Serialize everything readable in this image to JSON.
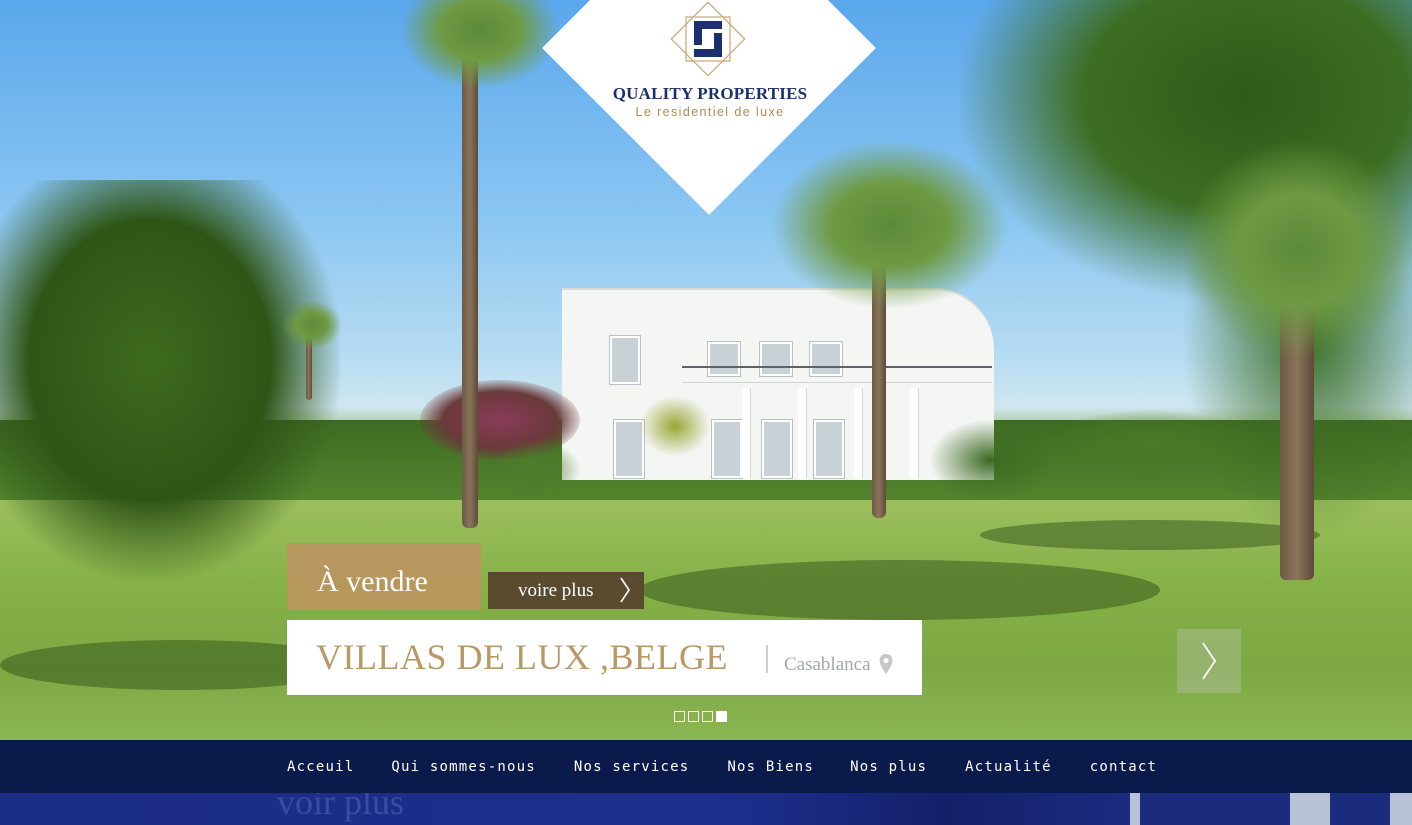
{
  "brand": {
    "name": "QUALITY PROPERTIES",
    "tagline": "Le residentiel de luxe",
    "colors": {
      "navy": "#1c2f6e",
      "gold": "#b08b55",
      "nav_bg": "#0a1a4a"
    }
  },
  "slide": {
    "status_label": "À vendre",
    "more_label": "voire plus",
    "title": "VILLAS DE LUX ,BELGE",
    "city": "Casablanca",
    "pin_icon": "map-pin-icon",
    "next_icon": "chevron-right-icon",
    "dots": [
      {
        "active": false
      },
      {
        "active": false
      },
      {
        "active": false
      },
      {
        "active": true
      }
    ]
  },
  "nav": {
    "items": [
      {
        "label": "Acceuil"
      },
      {
        "label": "Qui sommes-nous"
      },
      {
        "label": "Nos services"
      },
      {
        "label": "Nos Biens"
      },
      {
        "label": "Nos plus"
      },
      {
        "label": "Actualité"
      },
      {
        "label": "contact"
      }
    ]
  },
  "below": {
    "ghost_text": "voir plus"
  }
}
